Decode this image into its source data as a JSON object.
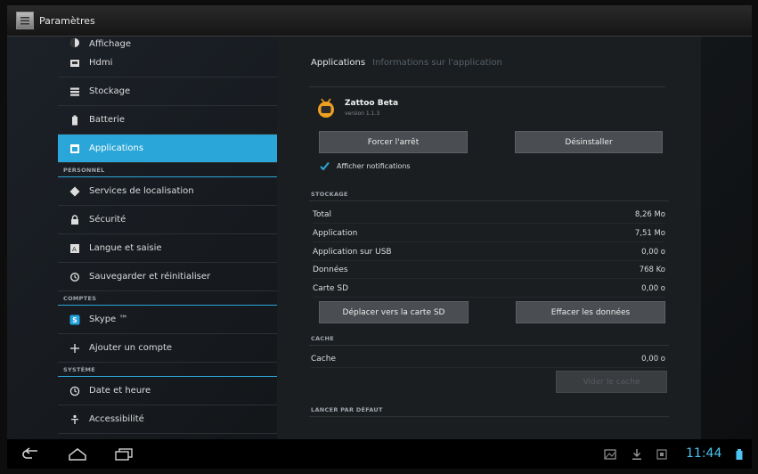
{
  "window": {
    "title": "Paramètres"
  },
  "sidebar": {
    "items": [
      {
        "label": "Affichage",
        "icon": "display-icon"
      },
      {
        "label": "Hdmi",
        "icon": "hdmi-icon"
      },
      {
        "label": "Stockage",
        "icon": "storage-icon"
      },
      {
        "label": "Batterie",
        "icon": "battery-icon"
      },
      {
        "label": "Applications",
        "icon": "apps-icon",
        "active": true
      }
    ],
    "section_personnel": "PERSONNEL",
    "personnel": [
      {
        "label": "Services de localisation",
        "icon": "location-icon"
      },
      {
        "label": "Sécurité",
        "icon": "lock-icon"
      },
      {
        "label": "Langue et saisie",
        "icon": "language-icon"
      },
      {
        "label": "Sauvegarder et réinitialiser",
        "icon": "backup-icon"
      }
    ],
    "section_comptes": "COMPTES",
    "comptes": [
      {
        "label": "Skype ™",
        "icon": "skype-icon"
      },
      {
        "label": "Ajouter un compte",
        "icon": "plus-icon"
      }
    ],
    "section_systeme": "SYSTÈME",
    "systeme": [
      {
        "label": "Date et heure",
        "icon": "clock-icon"
      },
      {
        "label": "Accessibilité",
        "icon": "accessibility-icon"
      }
    ]
  },
  "detail": {
    "breadcrumb_1": "Applications",
    "breadcrumb_2": "Informations sur l'application",
    "app_name": "Zattoo Beta",
    "app_version": "version 1.1.3",
    "force_stop": "Forcer l'arrêt",
    "uninstall": "Désinstaller",
    "show_notifications": "Afficher notifications",
    "storage_header": "STOCKAGE",
    "storage_rows": [
      {
        "label": "Total",
        "value": "8,26 Mo"
      },
      {
        "label": "Application",
        "value": "7,51 Mo"
      },
      {
        "label": "Application sur USB",
        "value": "0,00 o"
      },
      {
        "label": "Données",
        "value": "768 Ko"
      },
      {
        "label": "Carte SD",
        "value": "0,00 o"
      }
    ],
    "move_to_sd": "Déplacer vers la carte SD",
    "clear_data": "Effacer les données",
    "cache_header": "CACHE",
    "cache_label": "Cache",
    "cache_value": "0,00 o",
    "clear_cache": "Vider le cache",
    "launch_default_header": "LANCER PAR DÉFAUT"
  },
  "statusbar": {
    "time": "11:44"
  },
  "colors": {
    "accent": "#2ba6d8",
    "clock": "#4cc3f0",
    "app_icon": "#f0a020"
  }
}
